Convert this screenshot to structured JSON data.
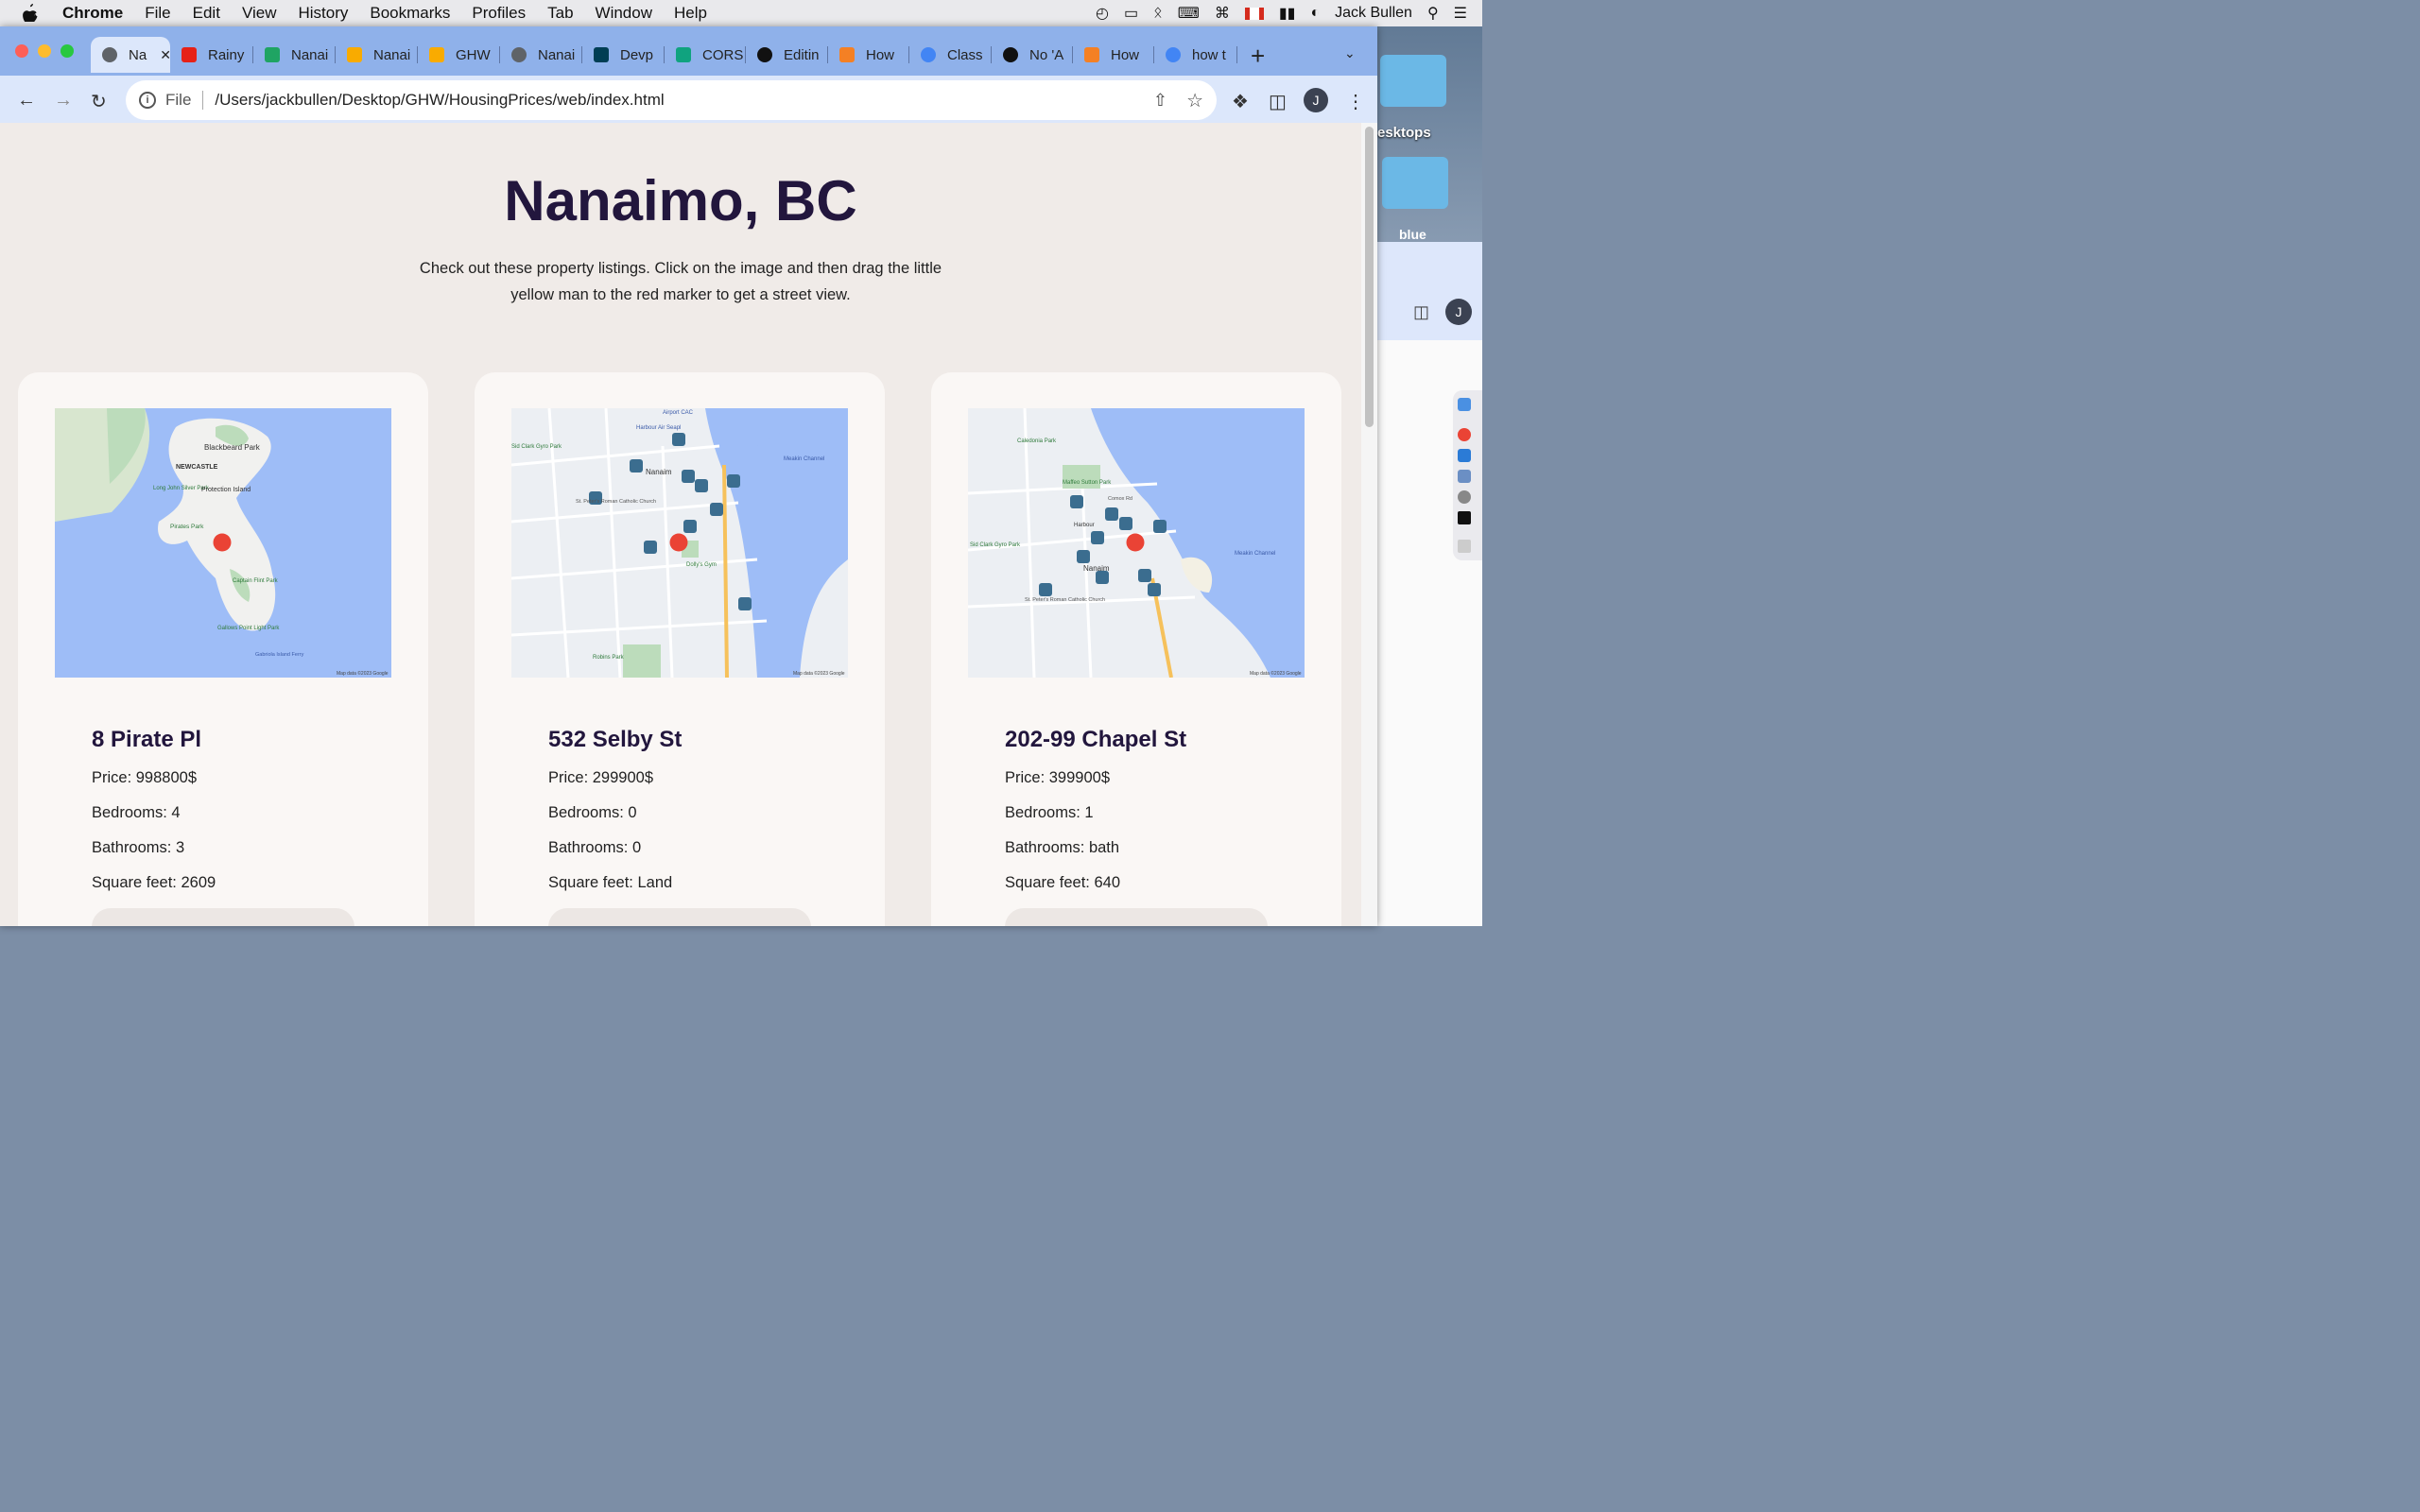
{
  "menubar": {
    "app": "Chrome",
    "items": [
      "File",
      "Edit",
      "View",
      "History",
      "Bookmarks",
      "Profiles",
      "Tab",
      "Window",
      "Help"
    ],
    "user": "Jack Bullen"
  },
  "desktop": {
    "label": "esktops",
    "folder_label": "blue"
  },
  "tabs": [
    {
      "title": "Na",
      "icon": "globe-icon",
      "color": "#5f6368",
      "active": true
    },
    {
      "title": "Rainy",
      "icon": "youtube-icon",
      "color": "#e62117"
    },
    {
      "title": "Nanai",
      "icon": "sheets-icon",
      "color": "#1fa463"
    },
    {
      "title": "Nanai",
      "icon": "colab-icon",
      "color": "#f9ab00"
    },
    {
      "title": "GHW",
      "icon": "colab-icon",
      "color": "#f9ab00"
    },
    {
      "title": "Nanai",
      "icon": "globe-icon",
      "color": "#5f6368"
    },
    {
      "title": "Devp",
      "icon": "devpost-icon",
      "color": "#003e54"
    },
    {
      "title": "CORS",
      "icon": "openai-icon",
      "color": "#10a37f"
    },
    {
      "title": "Editin",
      "icon": "github-icon",
      "color": "#111111"
    },
    {
      "title": "How",
      "icon": "stackoverflow-icon",
      "color": "#f48024"
    },
    {
      "title": "Class",
      "icon": "google-icon",
      "color": "#4285f4"
    },
    {
      "title": "No 'A",
      "icon": "github-icon",
      "color": "#111111"
    },
    {
      "title": "How",
      "icon": "stackoverflow-icon",
      "color": "#f48024"
    },
    {
      "title": "how t",
      "icon": "google-icon",
      "color": "#4285f4"
    }
  ],
  "omnibox": {
    "scheme": "File",
    "url": "/Users/jackbullen/Desktop/GHW/HousingPrices/web/index.html"
  },
  "profile_initial": "J",
  "page": {
    "title": "Nanaimo, BC",
    "subtitle": "Check out these property listings. Click on the image and then drag the little yellow man to the red marker to get a street view."
  },
  "listings": [
    {
      "address": "8 Pirate Pl",
      "price": "Price: 998800$",
      "bedrooms": "Bedrooms: 4",
      "bathrooms": "Bathrooms: 3",
      "sqft": "Square feet: 2609",
      "map_labels": [
        "Blackbeard Park",
        "NEWCASTLE",
        "Long John Silver Park",
        "Protection Island",
        "Pirates Park",
        "Captain Flint Park",
        "Gallows Point Light Park",
        "Gabriola Island Ferry"
      ],
      "map_credit": "Map data ©2023 Google"
    },
    {
      "address": "532 Selby St",
      "price": "Price: 299900$",
      "bedrooms": "Bedrooms: 0",
      "bathrooms": "Bathrooms: 0",
      "sqft": "Square feet: Land",
      "map_labels": [
        "Airport CAC",
        "Harbour Air Seapl",
        "Sid Clark Gyro Park",
        "Nanaim",
        "Meakin Channel",
        "St. Peter's Roman Catholic Church",
        "Dolly's Gym",
        "Robins Park"
      ],
      "map_credit": "Map data ©2023 Google"
    },
    {
      "address": "202-99 Chapel St",
      "price": "Price: 399900$",
      "bedrooms": "Bedrooms: 1",
      "bathrooms": "Bathrooms: bath",
      "sqft": "Square feet: 640",
      "map_labels": [
        "Caledonia Park",
        "Maffeo Sutton Park",
        "Comox Rd",
        "Harbour",
        "Sid Clark Gyro Park",
        "Nanaim",
        "Meakin Channel",
        "St. Peter's Roman Catholic Church"
      ],
      "map_credit": "Map data ©2023 Google"
    }
  ],
  "colors": {
    "accent": "#22163d",
    "marker": "#ea4335",
    "water": "#9ebdf7"
  }
}
